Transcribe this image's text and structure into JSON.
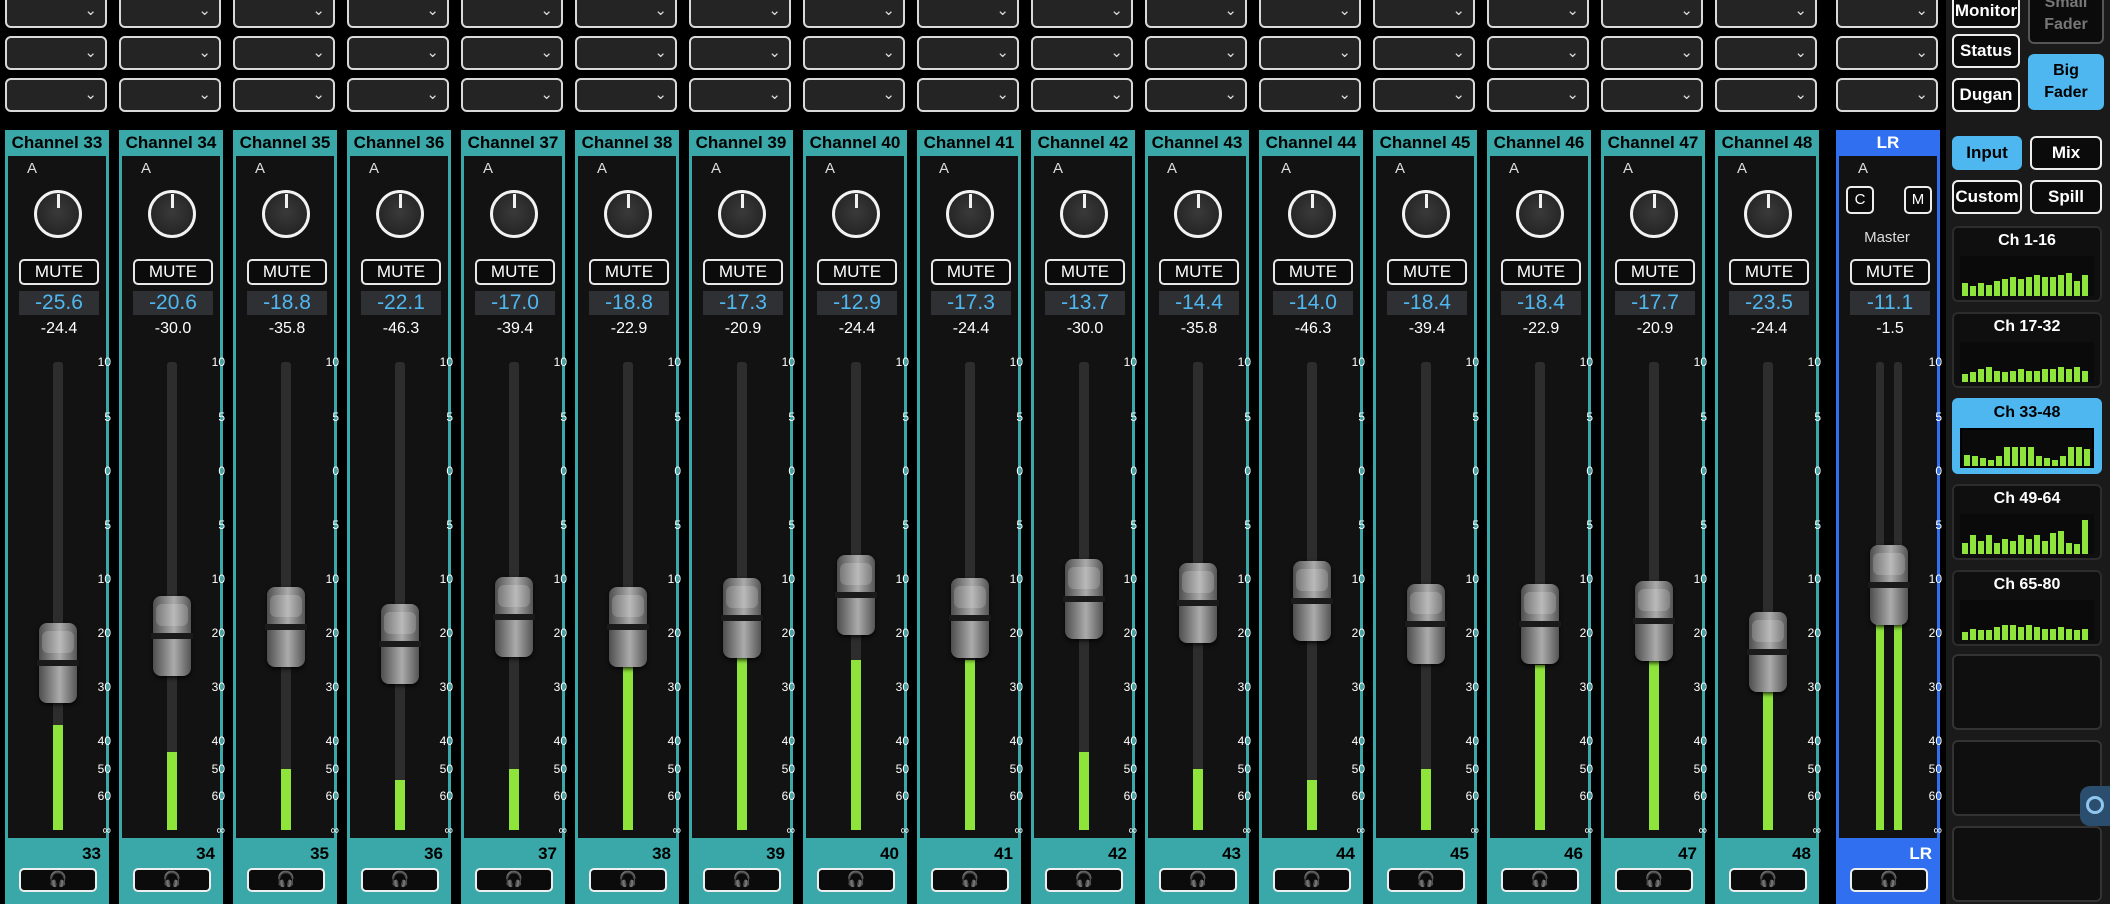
{
  "colors": {
    "channel_accent": "#3aa7a8",
    "master_accent": "#2f6ff0",
    "gain_text": "#4fb7f0",
    "meter": "#8ee43a",
    "selected": "#4fb7f0"
  },
  "strip_labels": {
    "mute": "MUTE",
    "a": "A",
    "headphone_icon": "🎧"
  },
  "dropdown_icon": "chevron-down-icon",
  "scale_ticks": [
    "10",
    "5",
    "0",
    "5",
    "10",
    "20",
    "30",
    "40",
    "50",
    "60",
    "∞"
  ],
  "channels": [
    {
      "name": "Channel 33",
      "num": "33",
      "gain": "-25.6",
      "peak": "-24.4",
      "fader_db": -25.6,
      "meter_db": -37
    },
    {
      "name": "Channel 34",
      "num": "34",
      "gain": "-20.6",
      "peak": "-30.0",
      "fader_db": -20.6,
      "meter_db": -44
    },
    {
      "name": "Channel 35",
      "num": "35",
      "gain": "-18.8",
      "peak": "-35.8",
      "fader_db": -18.8,
      "meter_db": -50
    },
    {
      "name": "Channel 36",
      "num": "36",
      "gain": "-22.1",
      "peak": "-46.3",
      "fader_db": -22.1,
      "meter_db": -54
    },
    {
      "name": "Channel 37",
      "num": "37",
      "gain": "-17.0",
      "peak": "-39.4",
      "fader_db": -17.0,
      "meter_db": -50
    },
    {
      "name": "Channel 38",
      "num": "38",
      "gain": "-18.8",
      "peak": "-22.9",
      "fader_db": -18.8,
      "meter_db": -26
    },
    {
      "name": "Channel 39",
      "num": "39",
      "gain": "-17.3",
      "peak": "-20.9",
      "fader_db": -17.3,
      "meter_db": -24
    },
    {
      "name": "Channel 40",
      "num": "40",
      "gain": "-12.9",
      "peak": "-24.4",
      "fader_db": -12.9,
      "meter_db": -25
    },
    {
      "name": "Channel 41",
      "num": "41",
      "gain": "-17.3",
      "peak": "-24.4",
      "fader_db": -17.3,
      "meter_db": -25
    },
    {
      "name": "Channel 42",
      "num": "42",
      "gain": "-13.7",
      "peak": "-30.0",
      "fader_db": -13.7,
      "meter_db": -44
    },
    {
      "name": "Channel 43",
      "num": "43",
      "gain": "-14.4",
      "peak": "-35.8",
      "fader_db": -14.4,
      "meter_db": -50
    },
    {
      "name": "Channel 44",
      "num": "44",
      "gain": "-14.0",
      "peak": "-46.3",
      "fader_db": -14.0,
      "meter_db": -54
    },
    {
      "name": "Channel 45",
      "num": "45",
      "gain": "-18.4",
      "peak": "-39.4",
      "fader_db": -18.4,
      "meter_db": -50
    },
    {
      "name": "Channel 46",
      "num": "46",
      "gain": "-18.4",
      "peak": "-22.9",
      "fader_db": -18.4,
      "meter_db": -26
    },
    {
      "name": "Channel 47",
      "num": "47",
      "gain": "-17.7",
      "peak": "-20.9",
      "fader_db": -17.7,
      "meter_db": -24
    },
    {
      "name": "Channel 48",
      "num": "48",
      "gain": "-23.5",
      "peak": "-24.4",
      "fader_db": -23.5,
      "meter_db": -28
    }
  ],
  "master": {
    "name": "LR",
    "num": "LR",
    "label": "Master",
    "c": "C",
    "m": "M",
    "gain": "-11.1",
    "peak": "-1.5",
    "fader_db": -11.1,
    "meter_db": -11
  },
  "panel": {
    "monitor": "Monitor",
    "small_fader": "Small Fader",
    "status": "Status",
    "big_fader": "Big Fader",
    "dugan": "Dugan",
    "input": "Input",
    "mix": "Mix",
    "custom": "Custom",
    "spill": "Spill",
    "banks": [
      {
        "label": "Ch 1-16",
        "levels": [
          0.35,
          0.25,
          0.35,
          0.3,
          0.4,
          0.45,
          0.5,
          0.45,
          0.5,
          0.55,
          0.5,
          0.5,
          0.55,
          0.6,
          0.4,
          0.55
        ],
        "selected": false
      },
      {
        "label": "Ch 17-32",
        "levels": [
          0.2,
          0.25,
          0.35,
          0.4,
          0.3,
          0.25,
          0.3,
          0.35,
          0.3,
          0.3,
          0.35,
          0.35,
          0.4,
          0.35,
          0.4,
          0.3
        ],
        "selected": false
      },
      {
        "label": "Ch 33-48",
        "levels": [
          0.3,
          0.25,
          0.2,
          0.15,
          0.25,
          0.5,
          0.5,
          0.5,
          0.5,
          0.25,
          0.2,
          0.15,
          0.25,
          0.5,
          0.5,
          0.45
        ],
        "selected": true
      },
      {
        "label": "Ch 49-64",
        "levels": [
          0.3,
          0.5,
          0.35,
          0.5,
          0.3,
          0.4,
          0.35,
          0.5,
          0.4,
          0.5,
          0.35,
          0.55,
          0.6,
          0.3,
          0.25,
          0.9
        ],
        "selected": false
      },
      {
        "label": "Ch 65-80",
        "levels": [
          0.2,
          0.3,
          0.25,
          0.25,
          0.35,
          0.4,
          0.4,
          0.35,
          0.4,
          0.35,
          0.3,
          0.3,
          0.35,
          0.3,
          0.25,
          0.3
        ],
        "selected": false
      }
    ]
  }
}
